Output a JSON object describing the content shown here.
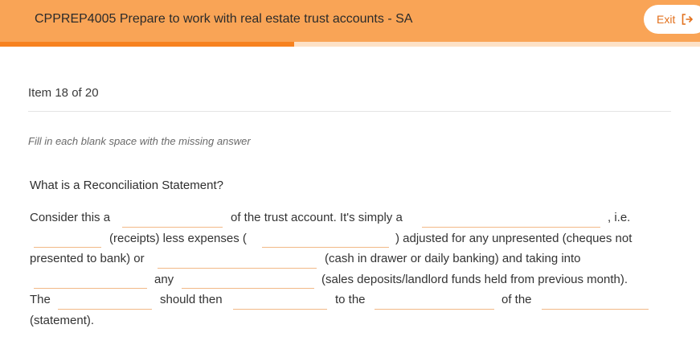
{
  "header": {
    "course_title": "CPPREP4005 Prepare to work with real estate trust accounts - SA",
    "exit_label": "Exit",
    "exit_icon": "exit-icon"
  },
  "progress": {
    "fraction": 0.42,
    "fill_color": "#f7821f",
    "track_color": "#fde1c6"
  },
  "item_counter": "Item 18 of 20",
  "instruction": "Fill in each blank space with the missing answer",
  "question": "What is a Reconciliation Statement?",
  "passage": {
    "s1": "Consider this a",
    "s2": "of the trust account. It's simply a",
    "s3": ", i.e.",
    "s4": "(receipts) less expenses (",
    "s5": ") adjusted for any unpresented (cheques not",
    "s6": "presented to bank) or",
    "s7": "(cash in drawer or daily banking) and taking into",
    "s8": "any",
    "s9": "(sales deposits/landlord funds held from previous month).",
    "s10": "The",
    "s11": "should then",
    "s12": "to the",
    "s13": "of the",
    "s14": "(statement)."
  },
  "blanks": [
    "",
    "",
    "",
    "",
    "",
    "",
    "",
    "",
    "",
    "",
    "",
    "",
    ""
  ],
  "colors": {
    "header": "#f9a456",
    "accent": "#e2701c",
    "blank_underline": "#f2b987"
  }
}
